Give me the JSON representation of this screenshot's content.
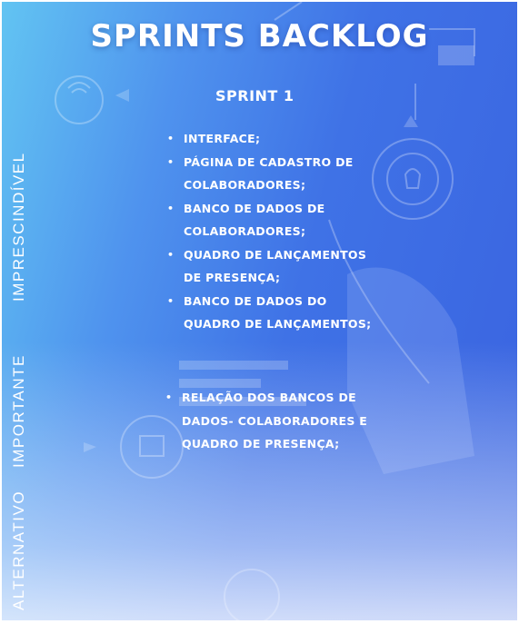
{
  "slide": {
    "title": "SPRINTS BACKLOG",
    "sprint_heading": "SPRINT 1",
    "priority_labels": [
      "IMPRESCINDÍVEL",
      "IMPORTANTE",
      "ALTERNATIVO"
    ],
    "essential_items": [
      "INTERFACE;",
      "PÁGINA DE CADASTRO DE COLABORADORES;",
      "BANCO DE DADOS DE COLABORADORES;",
      "QUADRO DE LANÇAMENTOS DE PRESENÇA;",
      "BANCO DE DADOS DO QUADRO DE LANÇAMENTOS;"
    ],
    "important_items": [
      "RELAÇÃO DOS BANCOS DE DADOS- COLABORADORES E QUADRO DE PRESENÇA;"
    ],
    "bullet_symbol": "•"
  },
  "colors": {
    "background_start": "#62c4f2",
    "background_end": "#3a63e0",
    "text": "#ffffff"
  }
}
